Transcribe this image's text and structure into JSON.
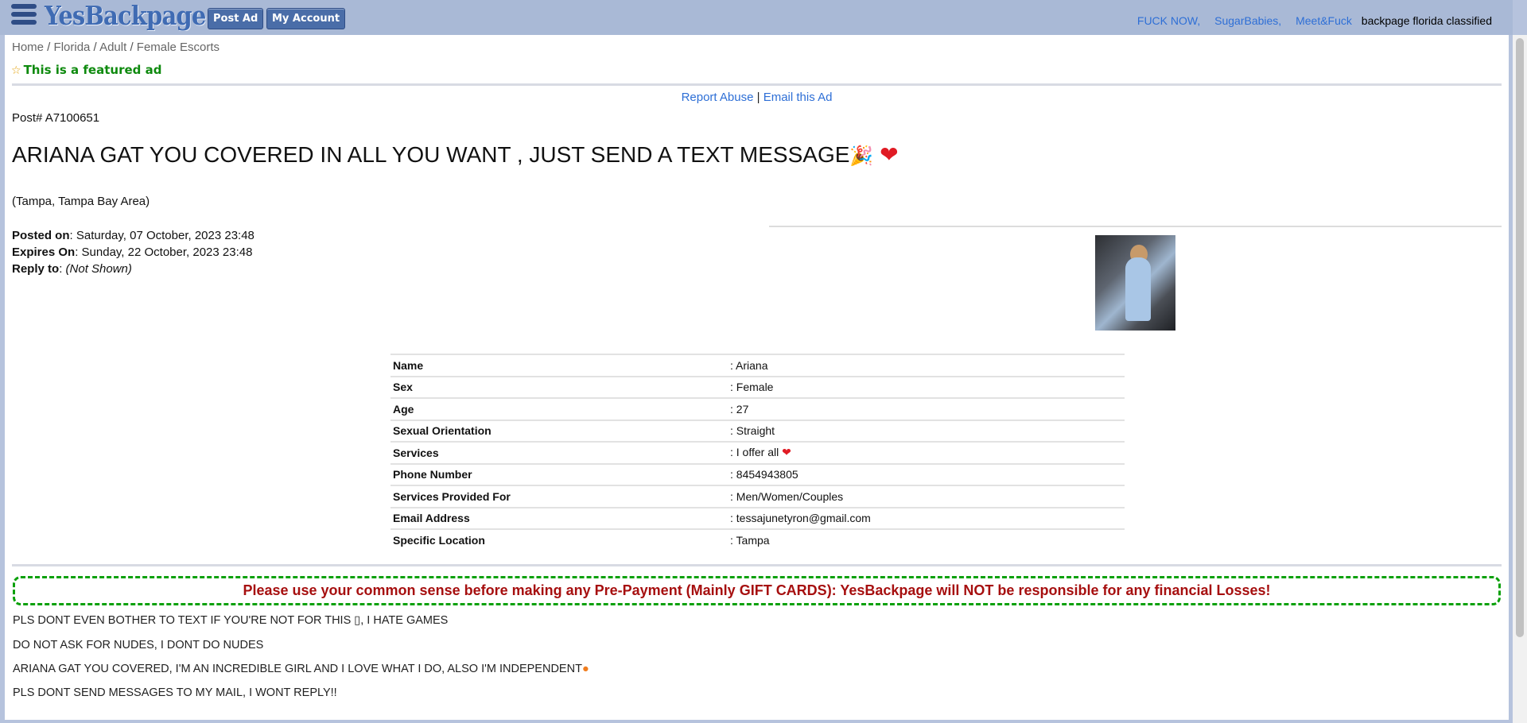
{
  "header": {
    "logo": "YesBackpage",
    "post_ad": "Post Ad",
    "my_account": "My Account",
    "links": [
      "FUCK NOW",
      "SugarBabies",
      "Meet&Fuck"
    ],
    "tagline": "backpage florida classified"
  },
  "breadcrumb": [
    "Home",
    "Florida",
    "Adult",
    "Female Escorts"
  ],
  "featured": "This is a featured ad",
  "actions": {
    "report": "Report Abuse",
    "email": "Email this Ad",
    "sep": "|"
  },
  "post_number": "Post# A7100651",
  "title": "ARIANA GAT YOU COVERED IN ALL YOU WANT , JUST SEND A TEXT MESSAGE",
  "location": "(Tampa, Tampa Bay Area)",
  "meta": {
    "posted_label": "Posted on",
    "posted_value": ": Saturday, 07 October, 2023  23:48",
    "expires_label": "Expires On",
    "expires_value": ": Sunday, 22 October, 2023  23:48",
    "reply_label": "Reply to",
    "reply_colon": ": ",
    "reply_value": "(Not Shown)"
  },
  "details": [
    {
      "key": "Name",
      "value": ": Ariana"
    },
    {
      "key": "Sex",
      "value": ": Female"
    },
    {
      "key": "Age",
      "value": ": 27"
    },
    {
      "key": "Sexual Orientation",
      "value": ": Straight"
    },
    {
      "key": "Services",
      "value": ": I offer all"
    },
    {
      "key": "Phone Number",
      "value": ": 8454943805"
    },
    {
      "key": "Services Provided For",
      "value": ": Men/Women/Couples"
    },
    {
      "key": "Email Address",
      "value": ": tessajunetyron@gmail.com"
    },
    {
      "key": "Specific Location",
      "value": ": Tampa"
    }
  ],
  "warning": "Please use your common sense before making any Pre-Payment (Mainly GIFT CARDS): YesBackpage will NOT be responsible for any financial Losses!",
  "body": [
    "PLS DONT EVEN BOTHER TO TEXT IF YOU'RE NOT FOR THIS ▯, I HATE GAMES",
    "DO NOT ASK FOR NUDES, I DONT DO NUDES",
    "ARIANA GAT YOU COVERED, I'M AN INCREDIBLE GIRL AND I LOVE WHAT I DO, ALSO I'M INDEPENDENT",
    "PLS DONT SEND MESSAGES TO MY MAIL, I WONT REPLY!!"
  ],
  "colors": {
    "header_bg": "#a9b9d6",
    "link": "#2e6fd6",
    "featured": "#0e8a0e",
    "warning_text": "#a60f0f",
    "warning_border": "#0aa00a"
  }
}
